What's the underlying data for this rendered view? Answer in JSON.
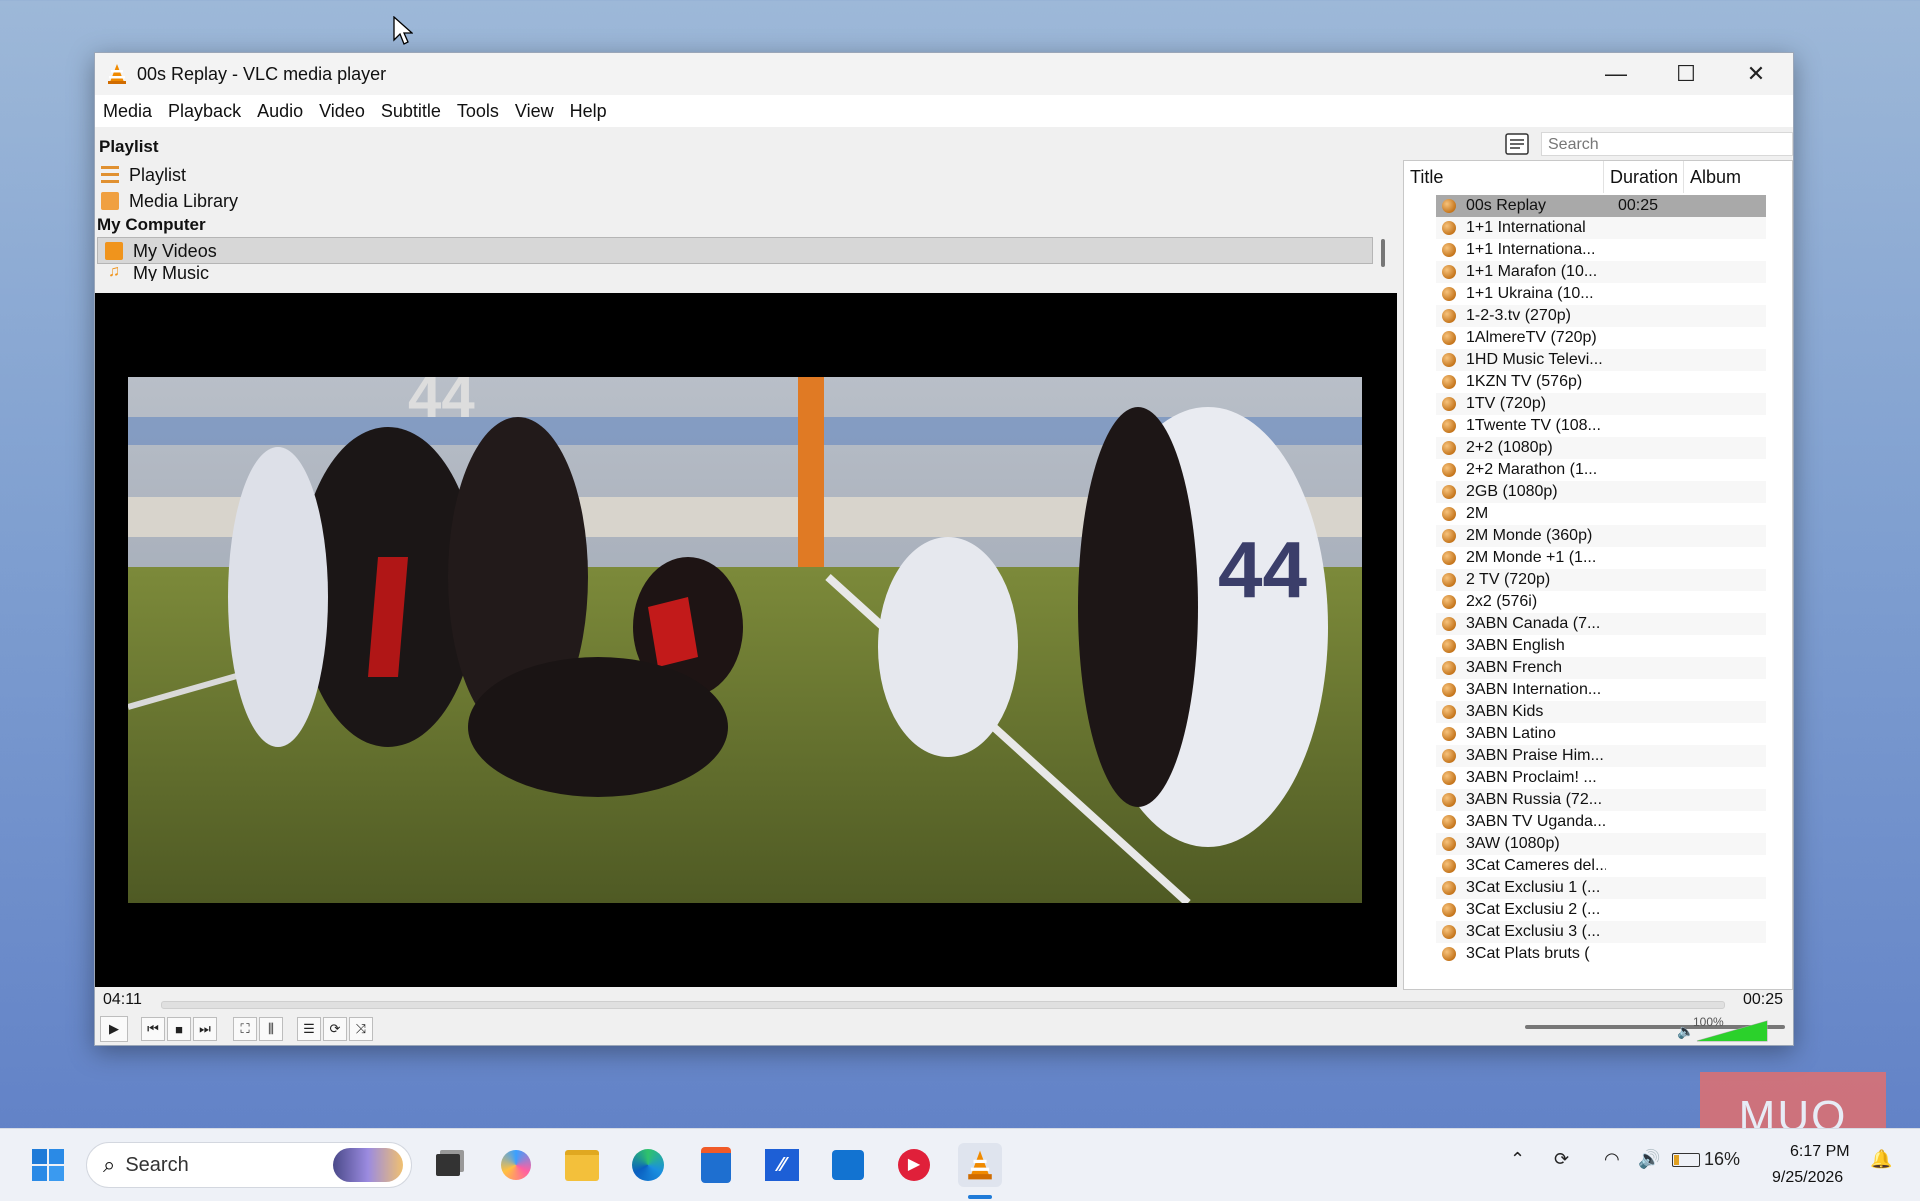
{
  "window": {
    "title": "00s Replay - VLC media player",
    "controls": {
      "minimize": "—",
      "maximize": "☐",
      "close": "✕"
    }
  },
  "menu": [
    "Media",
    "Playback",
    "Audio",
    "Video",
    "Subtitle",
    "Tools",
    "View",
    "Help"
  ],
  "sidebar": {
    "heading": "Playlist",
    "items": [
      {
        "label": "Playlist",
        "icon": "playlist-icon"
      },
      {
        "label": "Media Library",
        "icon": "media-library-icon"
      }
    ],
    "section": "My Computer",
    "computer_items": [
      {
        "label": "My Videos",
        "icon": "video-folder-icon"
      },
      {
        "label": "My Music",
        "icon": "music-icon"
      }
    ]
  },
  "playlist": {
    "search_placeholder": "Search",
    "columns": [
      "Title",
      "Duration",
      "Album"
    ],
    "rows": [
      {
        "title": "00s Replay",
        "duration": "00:25",
        "selected": true
      },
      {
        "title": "1+1 International",
        "duration": ""
      },
      {
        "title": "1+1 Internationa...",
        "duration": ""
      },
      {
        "title": "1+1 Marafon (10...",
        "duration": ""
      },
      {
        "title": "1+1 Ukraina (10...",
        "duration": ""
      },
      {
        "title": "1-2-3.tv (270p)",
        "duration": ""
      },
      {
        "title": "1AlmereTV (720p)",
        "duration": ""
      },
      {
        "title": "1HD Music Televi...",
        "duration": ""
      },
      {
        "title": "1KZN TV (576p)",
        "duration": ""
      },
      {
        "title": "1TV (720p)",
        "duration": ""
      },
      {
        "title": "1Twente TV (108...",
        "duration": ""
      },
      {
        "title": "2+2 (1080p)",
        "duration": ""
      },
      {
        "title": "2+2 Marathon (1...",
        "duration": ""
      },
      {
        "title": "2GB (1080p)",
        "duration": ""
      },
      {
        "title": "2M",
        "duration": ""
      },
      {
        "title": "2M Monde (360p)",
        "duration": ""
      },
      {
        "title": "2M Monde +1 (1...",
        "duration": ""
      },
      {
        "title": "2 TV (720p)",
        "duration": ""
      },
      {
        "title": "2x2 (576i)",
        "duration": ""
      },
      {
        "title": "3ABN Canada (7...",
        "duration": ""
      },
      {
        "title": "3ABN English",
        "duration": ""
      },
      {
        "title": "3ABN French",
        "duration": ""
      },
      {
        "title": "3ABN Internation...",
        "duration": ""
      },
      {
        "title": "3ABN Kids",
        "duration": ""
      },
      {
        "title": "3ABN Latino",
        "duration": ""
      },
      {
        "title": "3ABN Praise Him...",
        "duration": ""
      },
      {
        "title": "3ABN Proclaim! ...",
        "duration": ""
      },
      {
        "title": "3ABN Russia (72...",
        "duration": ""
      },
      {
        "title": "3ABN TV Uganda...",
        "duration": ""
      },
      {
        "title": "3AW (1080p)",
        "duration": ""
      },
      {
        "title": "3Cat Cameres del...",
        "duration": ""
      },
      {
        "title": "3Cat Exclusiu 1 (...",
        "duration": ""
      },
      {
        "title": "3Cat Exclusiu 2 (...",
        "duration": ""
      },
      {
        "title": "3Cat Exclusiu 3 (...",
        "duration": ""
      },
      {
        "title": "3Cat Plats bruts (",
        "duration": ""
      }
    ]
  },
  "player": {
    "elapsed": "04:11",
    "total": "00:25",
    "progress": 0.0,
    "volume_label": "100%",
    "volume": 1.0
  },
  "taskbar": {
    "search_placeholder": "Search",
    "battery": "16%",
    "time": "6:17 PM",
    "date": "9/25/2026"
  },
  "watermark": "MUO",
  "colors": {
    "vlc_orange": "#f08a00",
    "volume_green": "#2bd12b",
    "selection": "#a9a9a9"
  }
}
